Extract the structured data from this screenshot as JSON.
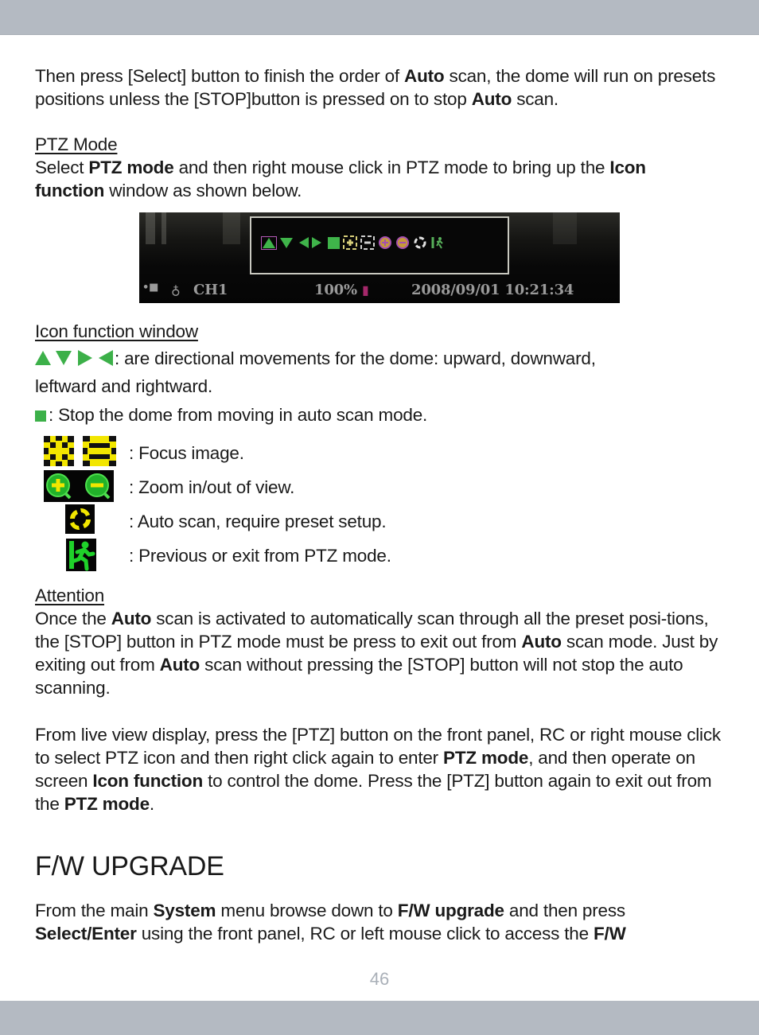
{
  "page_number": "46",
  "colors": {
    "band": "#b4bac2",
    "green": "#3cb049",
    "yellow": "#f2e600",
    "page_number": "#aab0b8"
  },
  "para1": {
    "t1": "Then press [Select] button to finish the order of ",
    "b1": "Auto",
    "t2": " scan, the dome will run on presets positions unless the [STOP]button is pressed on to stop ",
    "b2": "Auto",
    "t3": " scan."
  },
  "ptz_mode": {
    "heading": "PTZ Mode",
    "t1": "Select ",
    "b1": "PTZ mode",
    "t2": " and then right mouse click in PTZ mode to bring up the ",
    "b2": "Icon function",
    "t3": " window as shown below."
  },
  "osd": {
    "icons": [
      "up-arrow",
      "down-arrow",
      "left-arrow",
      "right-arrow",
      "stop-square",
      "focus-in",
      "focus-out",
      "zoom-in",
      "zoom-out",
      "auto-scan",
      "exit"
    ],
    "channel": "CH1",
    "zoom": "100%",
    "datetime": "2008/09/01 10:21:34"
  },
  "icon_function": {
    "heading": "Icon function window",
    "directional_desc": ": are directional movements for the dome: upward, downward,",
    "directional_desc2": "leftward and rightward.",
    "stop_desc": ": Stop the dome from moving in auto scan mode.",
    "items": [
      {
        "icon": "focus-icons",
        "desc": ": Focus image."
      },
      {
        "icon": "zoom-icons",
        "desc": ": Zoom in/out of view."
      },
      {
        "icon": "auto-scan-icon",
        "desc": ": Auto scan, require preset setup."
      },
      {
        "icon": "exit-icon",
        "desc": ": Previous or exit from PTZ mode."
      }
    ]
  },
  "attention": {
    "heading": "Attention",
    "t1": "Once the ",
    "b1": "Auto",
    "t2": " scan is activated to automatically scan through all the preset posi-tions, the [STOP] button in PTZ mode must be press to exit out from ",
    "b2": "Auto",
    "t3": " scan mode.  Just by exiting out from ",
    "b3": "Auto",
    "t4": " scan without pressing the [STOP] button will not stop the auto scanning."
  },
  "live_view": {
    "t1": "From live view display, press the [PTZ] button on the front panel, RC or right mouse click to select PTZ icon and then right click again to enter ",
    "b1": "PTZ mode",
    "t2": ", and then operate on screen ",
    "b2": "Icon function",
    "t3": " to control the dome.  Press the [PTZ] button again to exit out from the ",
    "b3": "PTZ mode",
    "t4": "."
  },
  "fw_upgrade": {
    "heading": "F/W UPGRADE",
    "t1": "From the main ",
    "b1": "System",
    "t2": " menu browse down to ",
    "b2": "F/W upgrade",
    "t3": " and then press ",
    "b3": "Select/Enter",
    "t4": " using the front panel, RC or left mouse click to access the ",
    "b4": "F/W"
  }
}
